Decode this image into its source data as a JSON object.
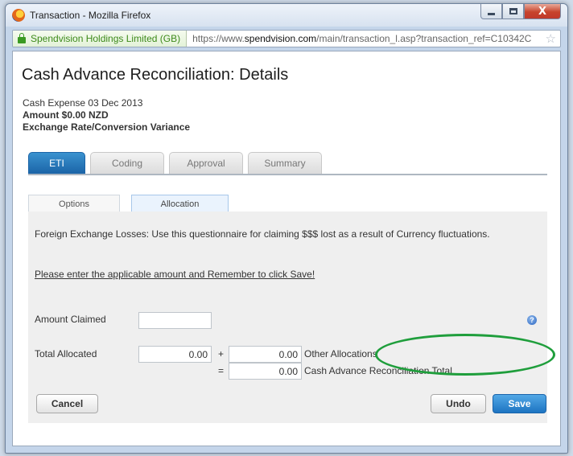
{
  "window": {
    "title": "Transaction - Mozilla Firefox",
    "controls": {
      "minimize": "",
      "maximize": "",
      "close": "X"
    }
  },
  "urlbar": {
    "identity": "Spendvision Holdings Limited (GB)",
    "url_prefix": "https://www.",
    "url_domain": "spendvision.com",
    "url_path": "/main/transaction_l.asp?transaction_ref=C10342C",
    "star": "☆"
  },
  "page": {
    "title": "Cash Advance Reconciliation: Details",
    "expense_line": "Cash Expense 03 Dec 2013",
    "amount_line": "Amount $0.00 NZD",
    "variance_line": "Exchange Rate/Conversion Variance"
  },
  "tabs": [
    "ETI",
    "Coding",
    "Approval",
    "Summary"
  ],
  "subtabs": [
    "Options",
    "Allocation"
  ],
  "panel": {
    "info": "Foreign Exchange Losses: Use this questionnaire for claiming $$$ lost as a result of Currency fluctuations.",
    "instruction": "Please enter the applicable amount and Remember to click Save!",
    "amount_claimed_label": "Amount Claimed",
    "amount_claimed_value": "",
    "total_allocated_label": "Total Allocated",
    "total_allocated_value": "0.00",
    "plus_sign": "+",
    "equals_sign": "=",
    "other_allocations_value": "0.00",
    "other_allocations_label": "Other Allocations",
    "reconciliation_total_value": "0.00",
    "reconciliation_total_label": "Cash Advance Reconciliation Total",
    "help_icon": "?"
  },
  "buttons": {
    "cancel": "Cancel",
    "undo": "Undo",
    "save": "Save"
  },
  "colors": {
    "accent_blue": "#1d74c2",
    "highlight_green": "#1f9e3c"
  }
}
